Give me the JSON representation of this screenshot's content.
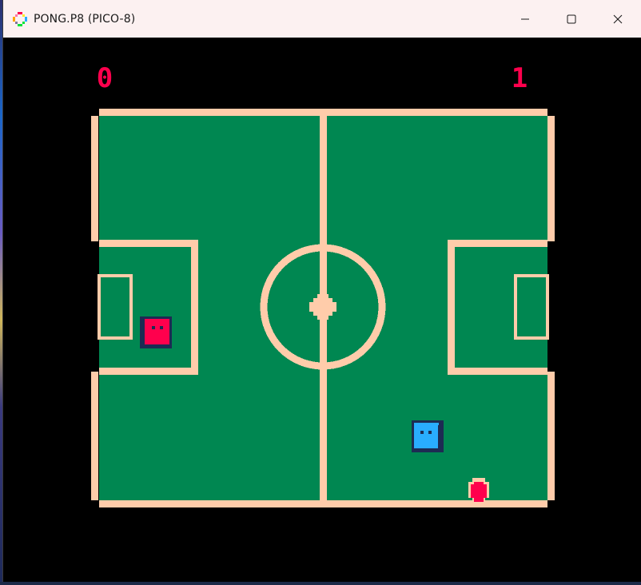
{
  "window": {
    "title": "PONG.P8 (PICO-8)",
    "app_icon": "pico8-logo-icon"
  },
  "controls": {
    "minimize": "minimize-icon",
    "maximize": "maximize-icon",
    "close": "close-icon"
  },
  "scores": {
    "left": "0",
    "right": "1"
  },
  "colors": {
    "field": "#008751",
    "lines": "#ffccaa",
    "score": "#ff004d",
    "player_red": "#ff004d",
    "player_blue": "#29adff",
    "outline": "#1d2b53",
    "ball": "#ff004d",
    "background": "#000000"
  }
}
